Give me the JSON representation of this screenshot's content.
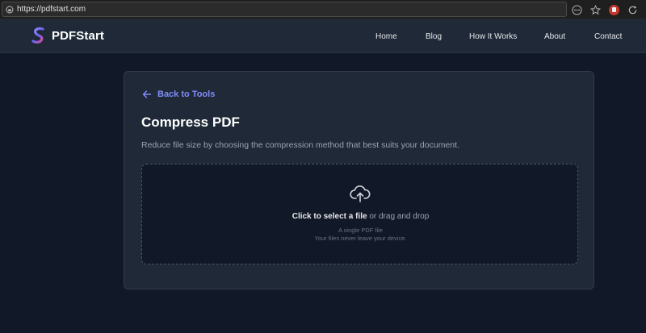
{
  "browser": {
    "url": "https://pdfstart.com"
  },
  "header": {
    "brand": "PDFStart",
    "nav": [
      {
        "label": "Home"
      },
      {
        "label": "Blog"
      },
      {
        "label": "How It Works"
      },
      {
        "label": "About"
      },
      {
        "label": "Contact"
      }
    ]
  },
  "main": {
    "back_label": "Back to Tools",
    "title": "Compress PDF",
    "subtitle": "Reduce file size by choosing the compression method that best suits your document.",
    "dropzone": {
      "cta_bold": "Click to select a file",
      "cta_rest": " or drag and drop",
      "note_1": "A single PDF file",
      "note_2": "Your files never leave your device."
    }
  },
  "colors": {
    "page_bg": "#111827",
    "card_bg": "#1f2937",
    "accent": "#818cf8"
  }
}
